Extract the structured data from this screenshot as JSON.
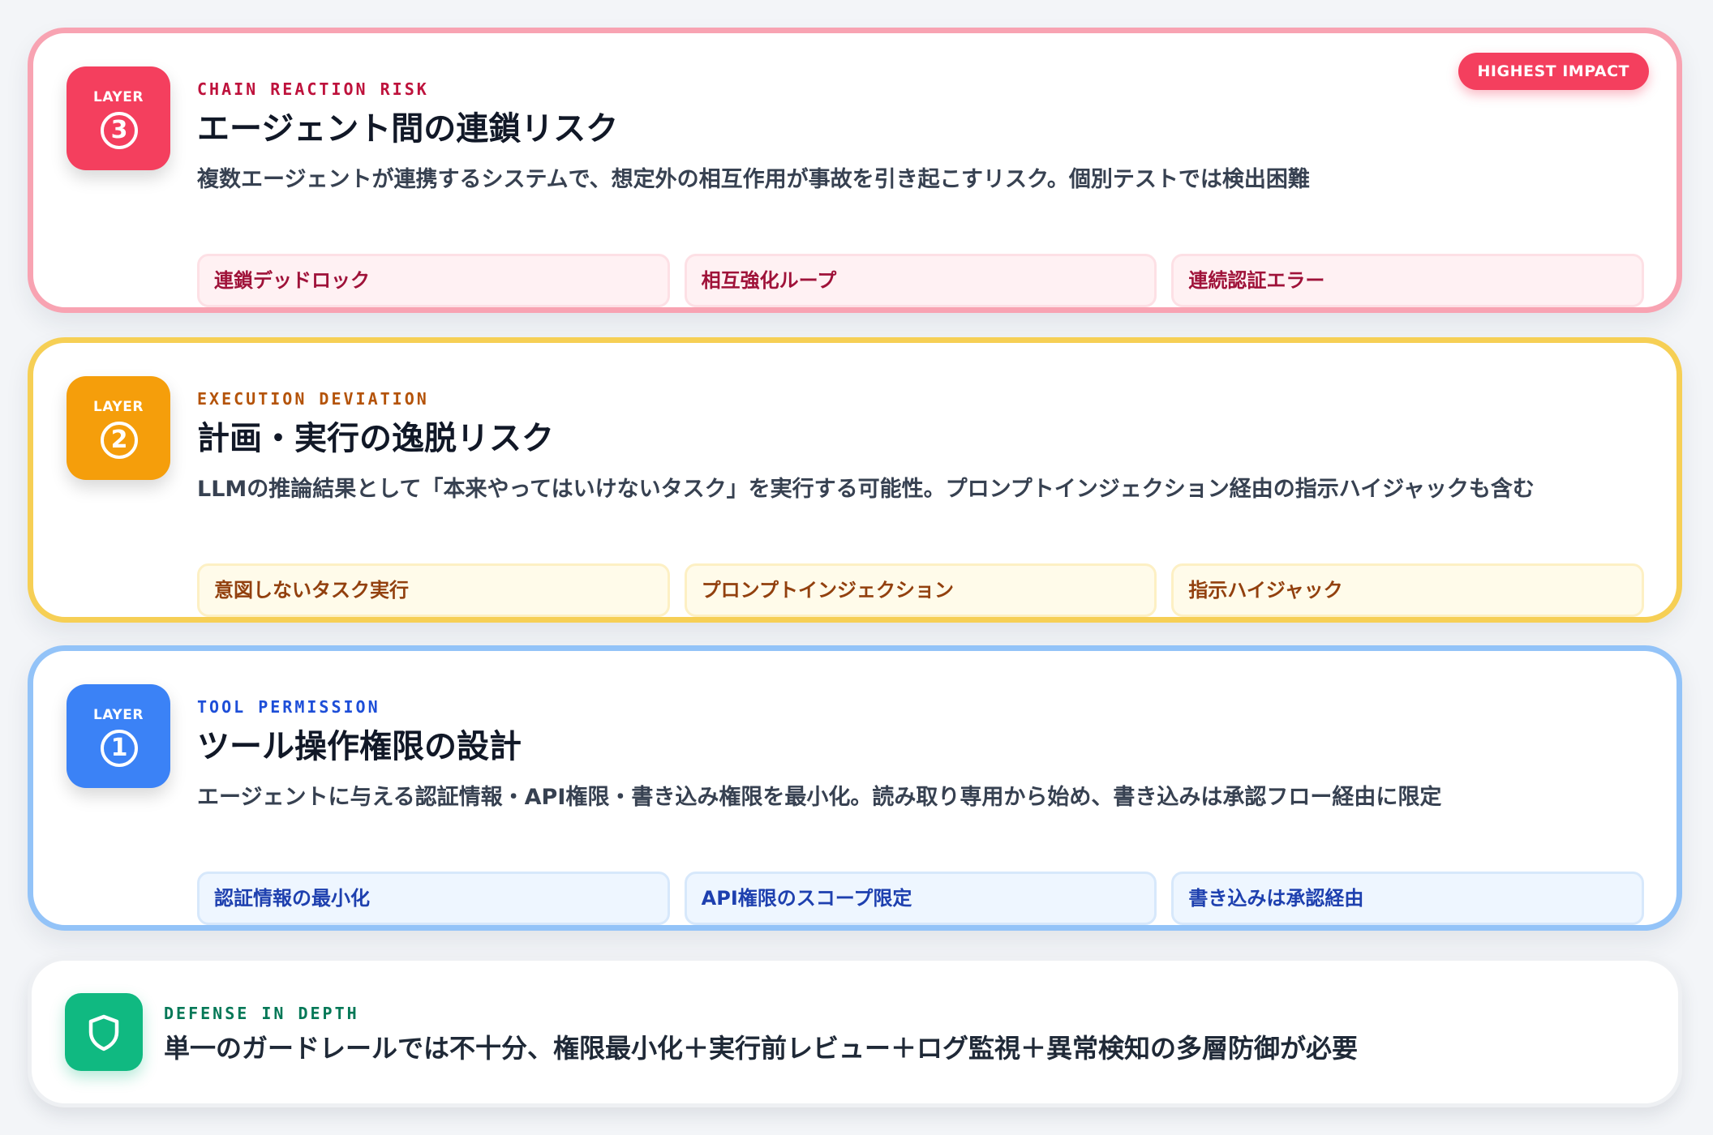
{
  "impact_badge": "HIGHEST IMPACT",
  "layers": [
    {
      "label": "LAYER",
      "number": "3",
      "eyebrow": "CHAIN REACTION RISK",
      "title": "エージェント間の連鎖リスク",
      "description": "複数エージェントが連携するシステムで、想定外の相互作用が事故を引き起こすリスク。個別テストでは検出困難",
      "chips": [
        "連鎖デッドロック",
        "相互強化ループ",
        "連続認証エラー"
      ],
      "accent": "#f43f5e"
    },
    {
      "label": "LAYER",
      "number": "2",
      "eyebrow": "EXECUTION DEVIATION",
      "title": "計画・実行の逸脱リスク",
      "description": "LLMの推論結果として「本来やってはいけないタスク」を実行する可能性。プロンプトインジェクション経由の指示ハイジャックも含む",
      "chips": [
        "意図しないタスク実行",
        "プロンプトインジェクション",
        "指示ハイジャック"
      ],
      "accent": "#f59e0b"
    },
    {
      "label": "LAYER",
      "number": "1",
      "eyebrow": "TOOL PERMISSION",
      "title": "ツール操作権限の設計",
      "description": "エージェントに与える認証情報・API権限・書き込み権限を最小化。読み取り専用から始め、書き込みは承認フロー経由に限定",
      "chips": [
        "認証情報の最小化",
        "API権限のスコープ限定",
        "書き込みは承認経由"
      ],
      "accent": "#3b82f6"
    }
  ],
  "defense": {
    "eyebrow": "DEFENSE IN DEPTH",
    "title": "単一のガードレールでは不十分、権限最小化＋実行前レビュー＋ログ監視＋異常検知の多層防御が必要",
    "icon": "shield-icon",
    "accent": "#10b981"
  }
}
